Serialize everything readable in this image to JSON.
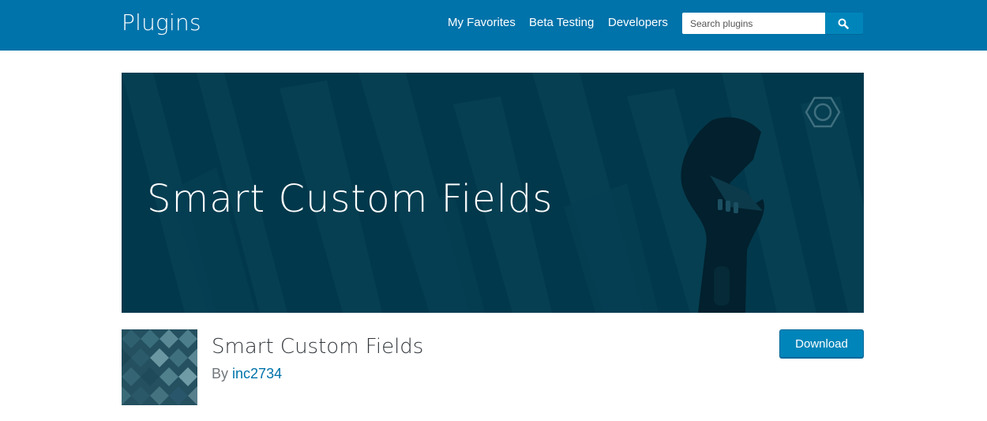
{
  "header": {
    "site_title": "Plugins",
    "nav": [
      {
        "label": "My Favorites"
      },
      {
        "label": "Beta Testing"
      },
      {
        "label": "Developers"
      }
    ],
    "search": {
      "placeholder": "Search plugins",
      "button_icon": "search-icon"
    }
  },
  "banner": {
    "title": "Smart Custom Fields",
    "icons": [
      "wrench-icon",
      "hexagon-nut-icon"
    ]
  },
  "plugin": {
    "name": "Smart Custom Fields",
    "by_prefix": "By",
    "author": "inc2734",
    "download_label": "Download"
  },
  "colors": {
    "header_bg": "#0073aa",
    "banner_bg": "#02384b",
    "button_bg": "#0085ba",
    "link": "#0073aa"
  }
}
